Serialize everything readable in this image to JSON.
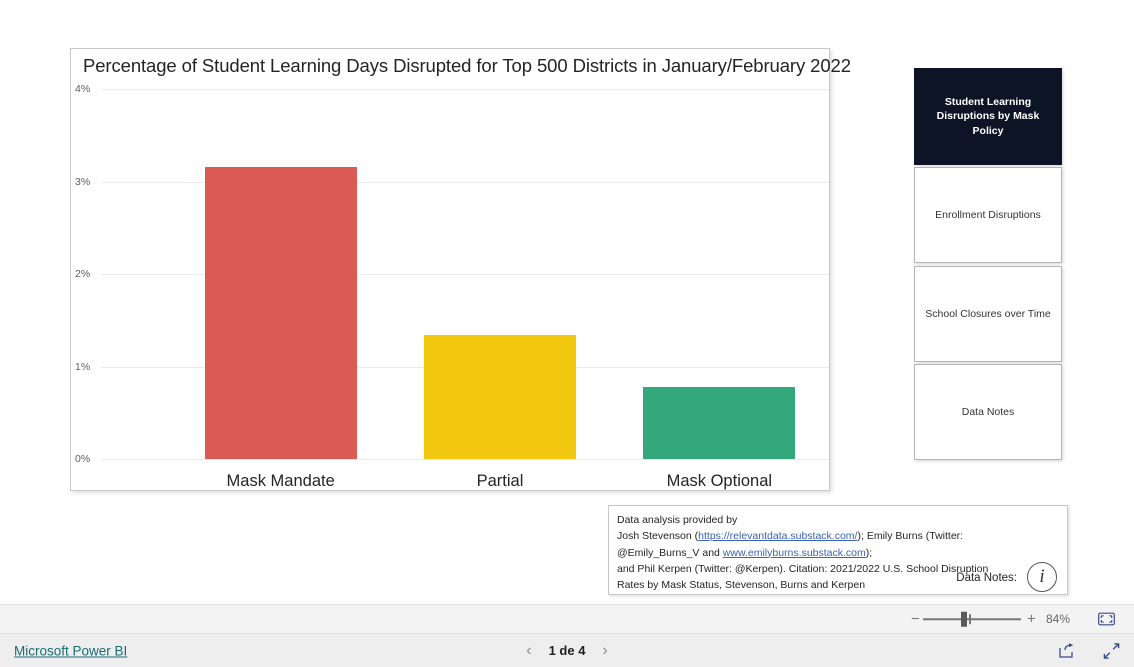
{
  "chart_data": {
    "type": "bar",
    "title": "Percentage of Student Learning Days Disrupted for Top 500 Districts in January/February 2022",
    "xlabel": "",
    "ylabel": "",
    "categories": [
      "Mask Mandate",
      "Partial",
      "Mask Optional"
    ],
    "values": [
      3.16,
      1.34,
      0.78
    ],
    "colors": [
      "#D95B54",
      "#F2C811",
      "#34A87C"
    ],
    "ylim": [
      0,
      4
    ],
    "ytick_labels": [
      "0%",
      "1%",
      "2%",
      "3%",
      "4%"
    ],
    "ytick_values": [
      0,
      1,
      2,
      3,
      4
    ],
    "grid": true,
    "legend": "none"
  },
  "nav": {
    "buttons": [
      {
        "label": "Student Learning Disruptions by Mask Policy",
        "active": true
      },
      {
        "label": "Enrollment Disruptions",
        "active": false
      },
      {
        "label": "School Closures over Time",
        "active": false
      },
      {
        "label": "Data Notes",
        "active": false
      }
    ]
  },
  "footnote": {
    "line1": "Data analysis provided by",
    "line2_pre": "Josh Stevenson (",
    "line2_link": "https://relevantdata.substack.com/",
    "line2_post": "); Emily Burns (Twitter:",
    "line3_pre": "@Emily_Burns_V and ",
    "line3_link": "www.emilyburns.substack.com",
    "line3_post": ");",
    "line4": "and Phil Kerpen (Twitter: @Kerpen). Citation: 2021/2022 U.S. School Disruption",
    "line5": "Rates by Mask Status, Stevenson, Burns and Kerpen",
    "data_notes_label": "Data Notes:",
    "info_icon": "i"
  },
  "zoombar": {
    "minus": "−",
    "plus": "+",
    "zoom_level": "84%",
    "fit_icon": "fit-to-page-icon"
  },
  "statusbar": {
    "brand_link": "Microsoft Power BI",
    "prev_icon": "‹",
    "next_icon": "›",
    "page_label": "1 de 4",
    "share_icon": "share-icon",
    "fullscreen_icon": "fullscreen-icon"
  }
}
